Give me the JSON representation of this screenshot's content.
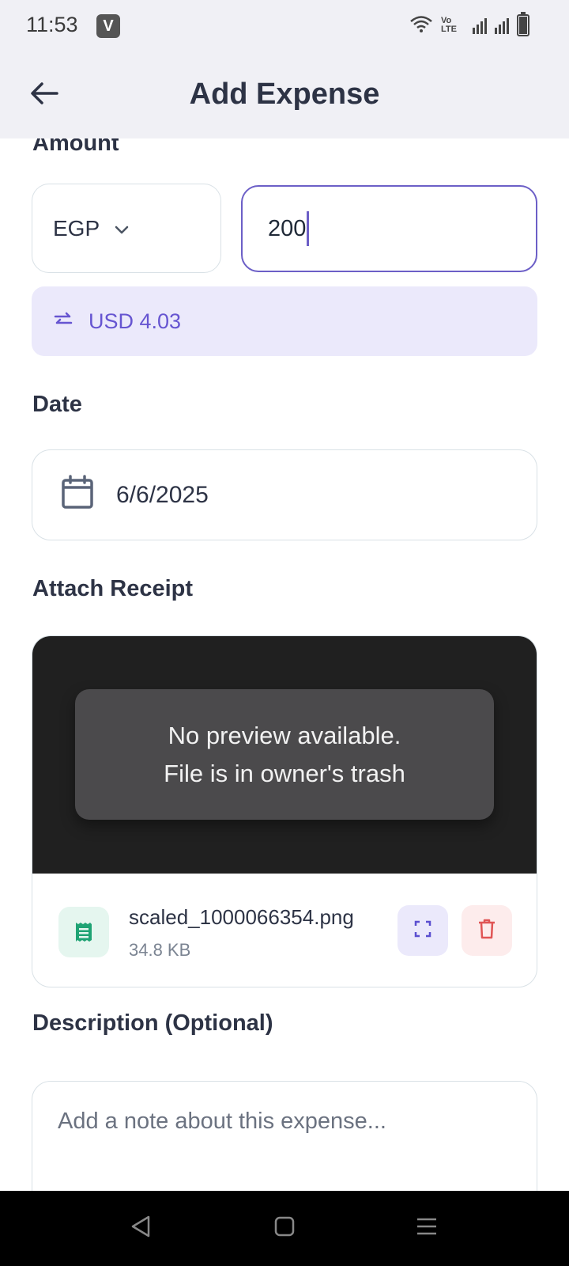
{
  "status_bar": {
    "time": "11:53",
    "app_badge": "V",
    "network": "Vo LTE"
  },
  "app_bar": {
    "title": "Add Expense"
  },
  "amount": {
    "label": "Amount",
    "currency": "EGP",
    "value": "200",
    "conversion": "USD 4.03"
  },
  "date": {
    "label": "Date",
    "value": "6/6/2025"
  },
  "receipt": {
    "label": "Attach Receipt",
    "preview_line1": "No preview available.",
    "preview_line2": "File is in owner's trash",
    "file_name": "scaled_1000066354.png",
    "file_size": "34.8 KB"
  },
  "description": {
    "label": "Description (Optional)",
    "placeholder": "Add a note about this expense..."
  },
  "colors": {
    "accent": "#6c5fc7",
    "conversion_bg": "#ebe9fb",
    "file_icon": "#1fa374",
    "delete": "#e05555"
  },
  "icons": [
    "back-arrow-icon",
    "chevron-down-icon",
    "swap-arrows-icon",
    "calendar-icon",
    "receipt-icon",
    "expand-icon",
    "trash-icon",
    "nav-back-icon",
    "nav-home-icon",
    "nav-menu-icon"
  ]
}
